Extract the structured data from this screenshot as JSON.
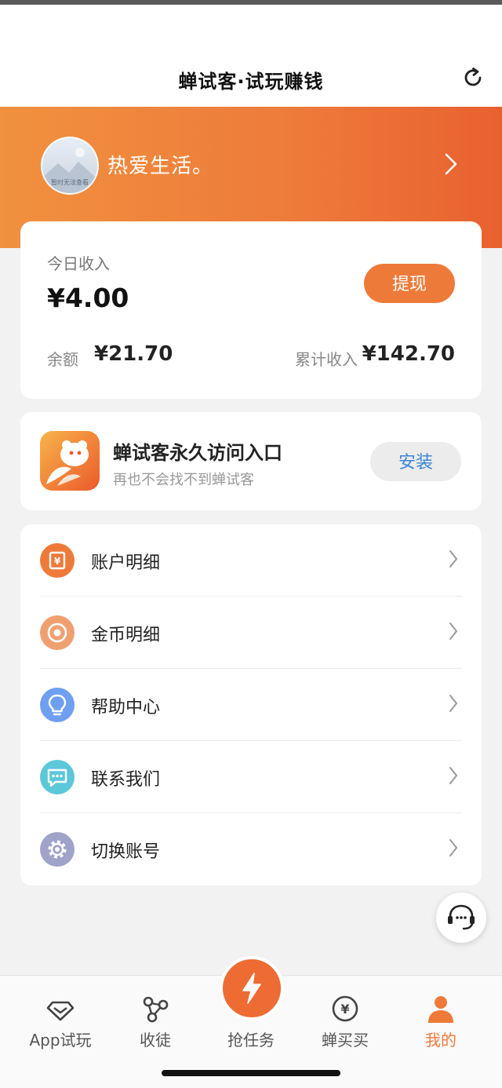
{
  "nav": {
    "title": "蝉试客·试玩赚钱",
    "refresh_icon": "refresh-icon"
  },
  "profile": {
    "username": "热爱生活。",
    "avatar_caption": "暂时无法查看"
  },
  "income": {
    "today_label": "今日收入",
    "today_value": "¥4.00",
    "withdraw_label": "提现",
    "balance_label": "余额",
    "balance_value": "¥21.70",
    "total_label": "累计收入",
    "total_value": "¥142.70"
  },
  "entry": {
    "title": "蝉试客永久访问入口",
    "subtitle": "再也不会找不到蝉试客",
    "install_label": "安装"
  },
  "menu": [
    {
      "label": "账户明细",
      "icon": "account-yuan-icon",
      "color": "#ee7a3a"
    },
    {
      "label": "金币明细",
      "icon": "coin-icon",
      "color": "#f0a070"
    },
    {
      "label": "帮助中心",
      "icon": "lightbulb-icon",
      "color": "#6f9ff0"
    },
    {
      "label": "联系我们",
      "icon": "chat-icon",
      "color": "#5cc7d9"
    },
    {
      "label": "切换账号",
      "icon": "gear-icon",
      "color": "#9fa3c9"
    }
  ],
  "tabs": [
    {
      "label": "App试玩",
      "icon": "diamond-icon"
    },
    {
      "label": "收徒",
      "icon": "share-icon"
    },
    {
      "label": "抢任务",
      "icon": "lightning-icon"
    },
    {
      "label": "蝉买买",
      "icon": "yuan-circle-icon"
    },
    {
      "label": "我的",
      "icon": "person-icon"
    }
  ],
  "colors": {
    "accent": "#ee7a3a",
    "link": "#3b86d6"
  }
}
